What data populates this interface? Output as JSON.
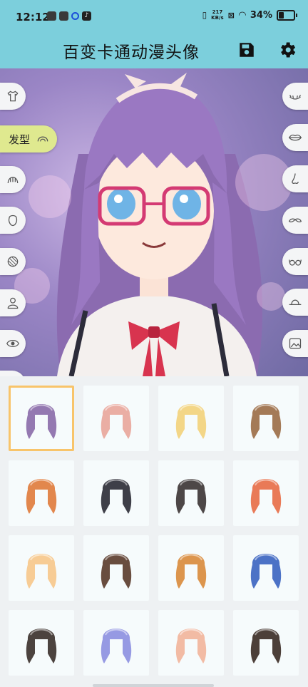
{
  "status_bar": {
    "time": "12:12",
    "speed_value": "217",
    "speed_unit": "KB/s",
    "battery_percent": "34%"
  },
  "app_bar": {
    "title": "百变卡通动漫头像",
    "save_icon": "save-icon",
    "settings_icon": "gear-icon"
  },
  "left_tabs": [
    {
      "name": "tab-clothes",
      "icon": "shirt-icon"
    },
    {
      "name": "tab-hairstyle",
      "icon": "hair-icon",
      "label": "发型",
      "active": true
    },
    {
      "name": "tab-bangs",
      "icon": "bangs-icon"
    },
    {
      "name": "tab-face",
      "icon": "face-shape-icon"
    },
    {
      "name": "tab-back-hair",
      "icon": "back-hair-icon"
    },
    {
      "name": "tab-body",
      "icon": "person-icon"
    },
    {
      "name": "tab-eyes",
      "icon": "eye-icon"
    },
    {
      "name": "tab-eye-toggle",
      "icon": "eye-icon"
    }
  ],
  "right_tabs": [
    {
      "name": "tab-eyelashes",
      "icon": "eyelash-icon"
    },
    {
      "name": "tab-mouth",
      "icon": "lips-icon"
    },
    {
      "name": "tab-nose",
      "icon": "nose-icon"
    },
    {
      "name": "tab-mustache",
      "icon": "mustache-icon"
    },
    {
      "name": "tab-glasses",
      "icon": "glasses-icon"
    },
    {
      "name": "tab-hat",
      "icon": "hat-icon"
    },
    {
      "name": "tab-background",
      "icon": "image-icon"
    }
  ],
  "hair_options": [
    {
      "color": "#8a6aa8",
      "selected": true
    },
    {
      "color": "#e9a59a"
    },
    {
      "color": "#f3d27a"
    },
    {
      "color": "#9b6b45"
    },
    {
      "color": "#e07a3a"
    },
    {
      "color": "#2a2a34"
    },
    {
      "color": "#3b3333"
    },
    {
      "color": "#e86b45"
    },
    {
      "color": "#f7c68a"
    },
    {
      "color": "#5a3a2a"
    },
    {
      "color": "#d98a3a"
    },
    {
      "color": "#3a63c0"
    },
    {
      "color": "#3a2f2a"
    },
    {
      "color": "#8c8fe0"
    },
    {
      "color": "#f2b49a"
    },
    {
      "color": "#3a2a24"
    }
  ]
}
